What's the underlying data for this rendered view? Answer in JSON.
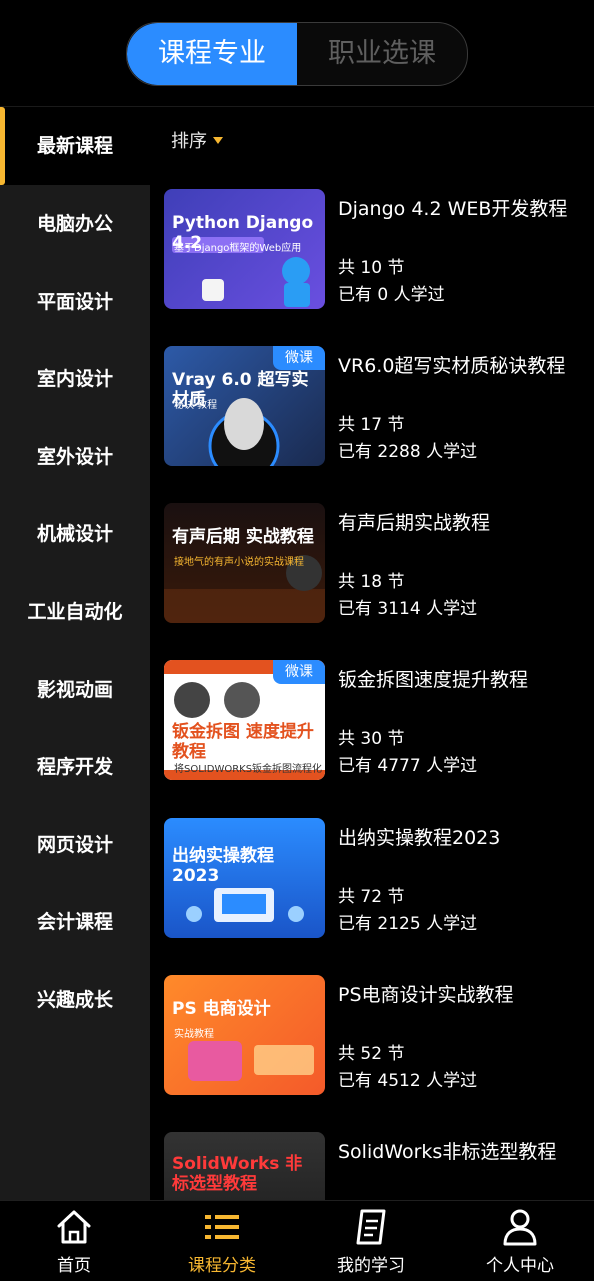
{
  "top_tabs": {
    "active": "课程专业",
    "inactive": "职业选课"
  },
  "sidebar": {
    "items": [
      {
        "label": "最新课程"
      },
      {
        "label": "电脑办公"
      },
      {
        "label": "平面设计"
      },
      {
        "label": "室内设计"
      },
      {
        "label": "室外设计"
      },
      {
        "label": "机械设计"
      },
      {
        "label": "工业自动化"
      },
      {
        "label": "影视动画"
      },
      {
        "label": "程序开发"
      },
      {
        "label": "网页设计"
      },
      {
        "label": "会计课程"
      },
      {
        "label": "兴趣成长"
      }
    ]
  },
  "sort_label": "排序",
  "courses": [
    {
      "title": "Django 4.2 WEB开发教程",
      "lessons": "共 10 节",
      "learned": "已有  0 人学过",
      "thumb_title": "Python Django 4.2",
      "thumb_sub": "基于Django框架的Web应用"
    },
    {
      "title": "VR6.0超写实材质秘诀教程",
      "lessons": "共 17 节",
      "learned": "已有  2288 人学过",
      "thumb_title": "Vray 6.0 超写实材质",
      "thumb_sub": "秘诀 教程",
      "badge": "微课"
    },
    {
      "title": "有声后期实战教程",
      "lessons": "共 18 节",
      "learned": "已有  3114 人学过",
      "thumb_title": "有声后期 实战教程",
      "thumb_sub": "接地气的有声小说的实战课程"
    },
    {
      "title": "钣金拆图速度提升教程",
      "lessons": "共 30 节",
      "learned": "已有  4777 人学过",
      "thumb_title": "钣金拆图 速度提升教程",
      "thumb_sub": "将SOLIDWORKS钣金拆图流程化",
      "badge": "微课"
    },
    {
      "title": "出纳实操教程2023",
      "lessons": "共 72 节",
      "learned": "已有  2125 人学过",
      "thumb_title": "出纳实操教程2023",
      "thumb_sub": ""
    },
    {
      "title": "PS电商设计实战教程",
      "lessons": "共 52 节",
      "learned": "已有  4512 人学过",
      "thumb_title": "PS 电商设计",
      "thumb_sub": "实战教程"
    },
    {
      "title": "SolidWorks非标选型教程",
      "lessons": "",
      "learned": "",
      "thumb_title": "SolidWorks 非标选型教程",
      "thumb_sub": ""
    }
  ],
  "bottom_nav": [
    {
      "label": "首页",
      "icon": "home-icon"
    },
    {
      "label": "课程分类",
      "icon": "list-icon"
    },
    {
      "label": "我的学习",
      "icon": "notebook-icon"
    },
    {
      "label": "个人中心",
      "icon": "person-icon"
    }
  ],
  "colors": {
    "accent_blue": "#2b8cff",
    "accent_yellow": "#f7b731",
    "sidebar_bg": "#1b1b1b"
  }
}
